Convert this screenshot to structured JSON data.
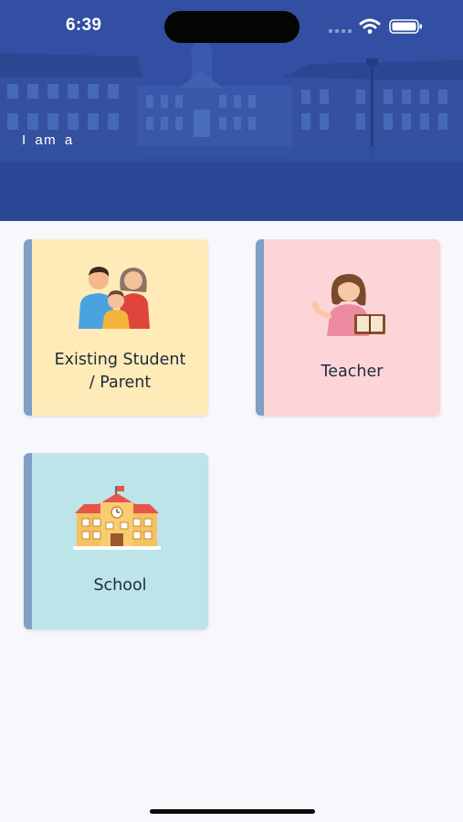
{
  "status_bar": {
    "time": "6:39",
    "icons": [
      "signal-icon",
      "wifi-icon",
      "battery-icon"
    ]
  },
  "header": {
    "intro_text": "I am a",
    "background": "campus-building-photo",
    "overlay_color": "#2f4a9e"
  },
  "roles": [
    {
      "label": "Existing Student / Parent",
      "line1": "Existing Student",
      "line2": "/ Parent",
      "icon": "family-icon",
      "background": "#feebb8"
    },
    {
      "label": "Teacher",
      "icon": "teacher-icon",
      "background": "#fdd5d9"
    },
    {
      "label": "School",
      "icon": "school-building-icon",
      "background": "#bde4e8"
    }
  ],
  "colors": {
    "card_stripe": "#7f9fc4",
    "page_background": "#f8f8fc",
    "label_text": "#1f2a3a"
  }
}
